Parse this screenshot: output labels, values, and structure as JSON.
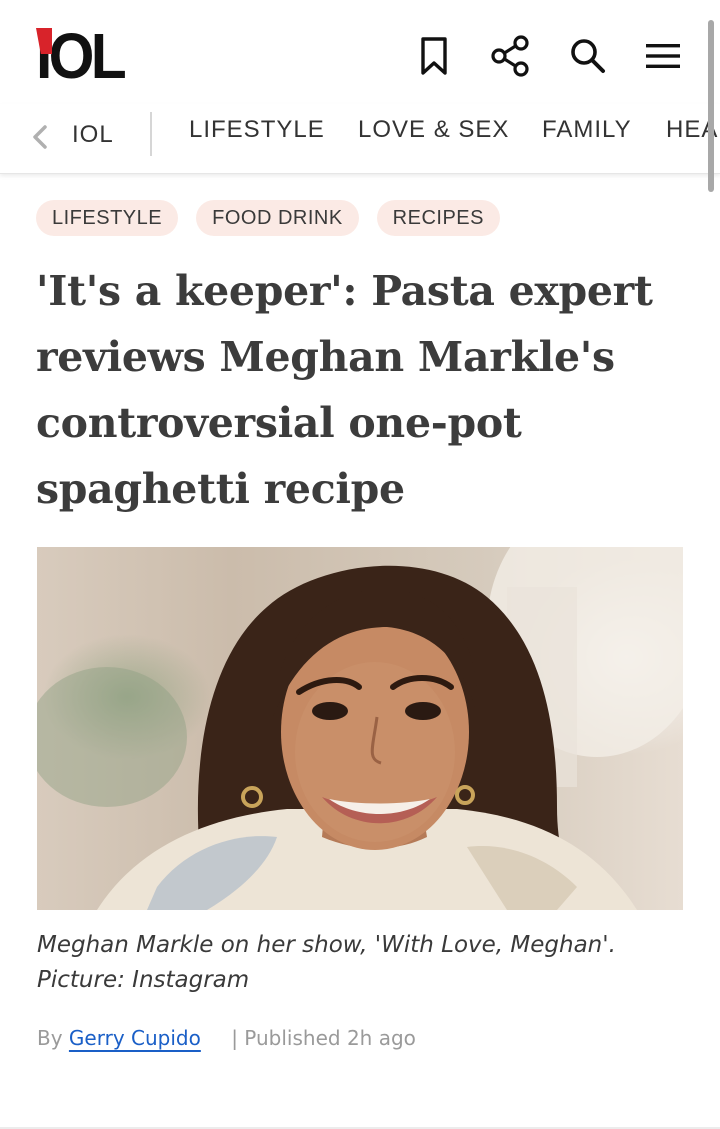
{
  "header": {
    "logo_text": "IOL",
    "icons": [
      "bookmark-icon",
      "share-icon",
      "search-icon",
      "menu-icon"
    ]
  },
  "nav": {
    "home_label": "IOL",
    "items": [
      "LIFESTYLE",
      "LOVE & SEX",
      "FAMILY",
      "HEA"
    ]
  },
  "article": {
    "tags": [
      "LIFESTYLE",
      "FOOD DRINK",
      "RECIPES"
    ],
    "headline": "'It's a keeper': Pasta expert reviews Meghan Markle's controversial one-pot spaghetti recipe",
    "caption": "Meghan Markle on her show, 'With Love, Meghan'. Picture: Instagram",
    "byline": {
      "prefix": "By",
      "author": "Gerry Cupido",
      "published": "| Published 2h ago"
    }
  },
  "colors": {
    "accent_red": "#d8232a",
    "tag_bg": "#fbeae5",
    "link_blue": "#1a5fc7"
  }
}
